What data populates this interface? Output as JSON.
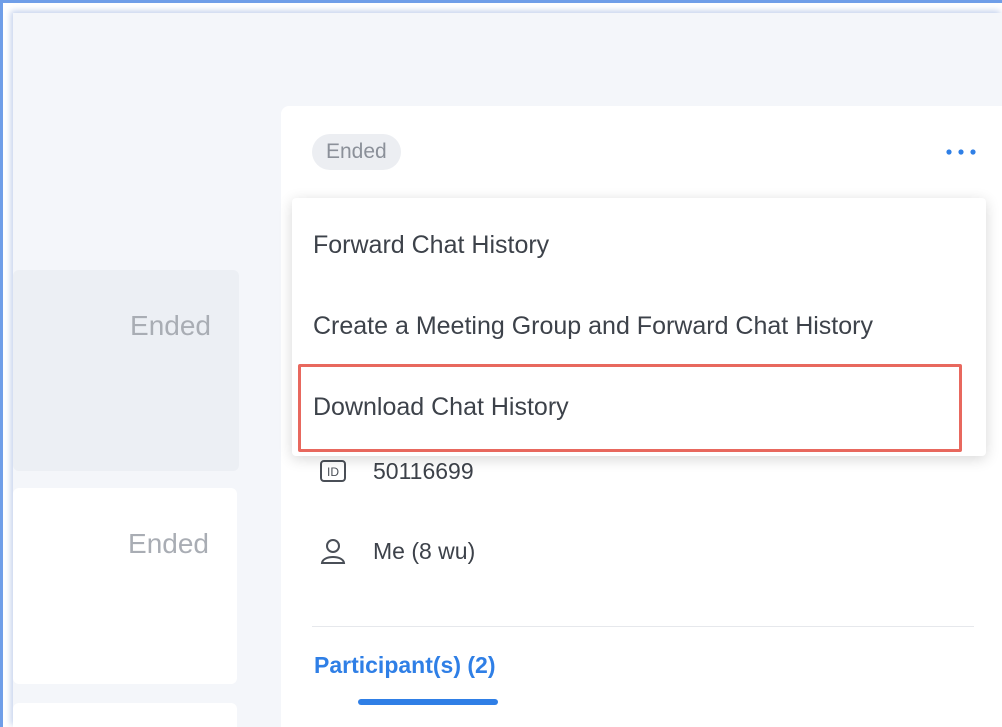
{
  "list": {
    "items": [
      {
        "status": "Ended"
      },
      {
        "status": "Ended"
      }
    ]
  },
  "detail": {
    "status_badge": "Ended",
    "more_label": "...",
    "meeting_id": "50116699",
    "host": "Me (8 wu)",
    "participants_tab": "Participant(s) (2)"
  },
  "menu": {
    "items": [
      {
        "label": "Forward Chat History"
      },
      {
        "label": "Create a Meeting Group and Forward Chat History"
      },
      {
        "label": "Download Chat History"
      }
    ],
    "highlight_color": "#e8685e"
  },
  "colors": {
    "accent": "#2f7fe6",
    "muted_text": "#a9adb4",
    "background": "#f4f6fa"
  },
  "icons": [
    "id-icon",
    "user-icon",
    "more-icon"
  ]
}
